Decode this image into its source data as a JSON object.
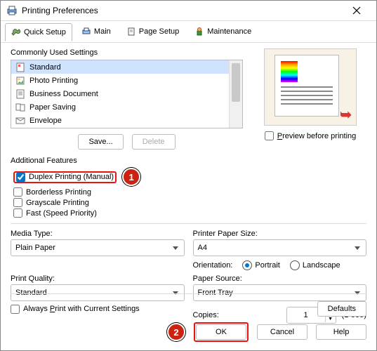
{
  "window": {
    "title": "Printing Preferences"
  },
  "tabs": {
    "quick": "Quick Setup",
    "main": "Main",
    "page": "Page Setup",
    "maint": "Maintenance"
  },
  "commonly_used": {
    "group_label": "Commonly Used Settings",
    "items": [
      "Standard",
      "Photo Printing",
      "Business Document",
      "Paper Saving",
      "Envelope"
    ],
    "save_btn": "Save...",
    "delete_btn": "Delete"
  },
  "preview_checkbox": "Preview before printing",
  "additional_features": {
    "group_label": "Additional Features",
    "duplex": "Duplex Printing (Manual)",
    "borderless": "Borderless Printing",
    "grayscale": "Grayscale Printing",
    "fast": "Fast (Speed Priority)"
  },
  "media_type": {
    "label": "Media Type:",
    "value": "Plain Paper"
  },
  "print_quality": {
    "label": "Print Quality:",
    "value": "Standard"
  },
  "paper_size": {
    "label": "Printer Paper Size:",
    "value": "A4"
  },
  "orientation": {
    "label": "Orientation:",
    "portrait": "Portrait",
    "landscape": "Landscape"
  },
  "paper_source": {
    "label": "Paper Source:",
    "value": "Front Tray"
  },
  "copies": {
    "label": "Copies:",
    "value": "1",
    "range": "(1-999)"
  },
  "always_print": "Always Print with Current Settings",
  "buttons": {
    "defaults": "Defaults",
    "ok": "OK",
    "cancel": "Cancel",
    "help": "Help"
  },
  "annotations": {
    "one": "1",
    "two": "2"
  }
}
